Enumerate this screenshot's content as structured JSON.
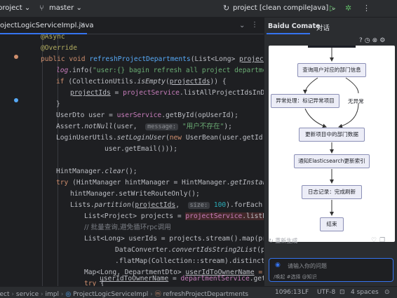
{
  "titlebar": {
    "project": "project",
    "branch": "master",
    "run_config": "project [clean compileJava]"
  },
  "editor": {
    "tab_label": "ojectLogicServiceImpl.java",
    "code": {
      "l0": "@Async",
      "l1": "@Override",
      "l2_a": "public void ",
      "l2_b": "refreshProjectDepartments",
      "l2_c": "(List<Long> ",
      "l2_d": "projectIds",
      "l2_e": ",",
      "l3_a": "log",
      "l3_b": ".info(",
      "l3_c": "\"user:{} bagin refresh all project departments\"",
      "l4_a": "if ",
      "l4_b": "(CollectionUtils.",
      "l4_c": "isEmpty",
      "l4_d": "(",
      "l4_e": "projectIds",
      "l4_f": ")) {",
      "l5_a": "projectIds",
      "l5_b": " = ",
      "l5_c": "projectService",
      "l5_d": ".listAllProjectIdsInDb(",
      "l6": "}",
      "l7_a": "UserDto user = ",
      "l7_b": "userService",
      "l7_c": ".getById(opUserId);",
      "l8_a": "Assert.",
      "l8_b": "notNull",
      "l8_c": "(user,  ",
      "l8_d": "message:",
      "l8_e": " \"用户不存在\"",
      "l8_f": ");",
      "l9_a": "LoginUserUtils.",
      "l9_b": "setLoginUser",
      "l9_c": "(",
      "l9_d": "new ",
      "l9_e": "UserBean(user.getId(), u",
      "l10": "user.getEmail()));",
      "l11_a": "HintManager.",
      "l11_b": "clear",
      "l11_c": "();",
      "l12_a": "try ",
      "l12_b": "(HintManager hintManager = HintManager.",
      "l12_c": "getInstance",
      "l12_d": "()",
      "l13": "hintManager.setWriteRouteOnly();",
      "l14_a": "Lists.",
      "l14_b": "partition",
      "l14_c": "(",
      "l14_d": "projectIds",
      "l14_e": ",  ",
      "l14_f": "size:",
      "l14_g": " 100",
      "l14_h": ").forEach(ids ->",
      "l15_a": "List<Project> projects = ",
      "l15_b": "projectService",
      "l15_c": ".listProj",
      "l16": "// 批量查询,避免循环rpc调用",
      "l17_a": "List<Long> userIds = projects.stream().map(proje",
      "l18_a": "DataConverter.",
      "l18_b": "convertIdsString2List",
      "l18_c": "(proj",
      "l19_a": ".flatMap(Collection::stream).distinct()",
      "l20_a": "Map<Long, DepartmentDto> ",
      "l20_b": "userIdToOwnerName",
      "l20_c": " = new",
      "l21_a": "try ",
      "l21_b": "{",
      "l22_a": "userIdToOwnerName",
      "l22_b": " = ",
      "l22_c": "departmentService",
      "l22_d": ".getOwn"
    }
  },
  "panel": {
    "title": "Baidu Comate",
    "tab": "对话",
    "flowchart": {
      "node1": "查询用户对应的部门信息",
      "node2": "异常处理：标记异常项目",
      "label_no_exception": "无异常",
      "node3": "更新项目中的部门数据",
      "node4": "通知Elasticsearch更新索引",
      "node5": "日志记录：完成刷新",
      "node6": "结束"
    },
    "regenerate": "重新生成",
    "input_placeholder": "请输入你的问题",
    "input_hint": "/唤起  #选择  @知识"
  },
  "statusbar": {
    "breadcrumb": [
      "ject",
      "service",
      "impl",
      "ProjectLogicServiceImpl",
      "refreshProjectDepartments"
    ],
    "position": "1096:13",
    "line_sep": "LF",
    "encoding": "UTF-8",
    "indent": "4 spaces"
  },
  "colors": {
    "accent": "#3574f0",
    "keyword": "#cf8e6d",
    "method": "#56a8f5",
    "field": "#c77dbb",
    "string": "#6aab73",
    "run_green": "#5fb865"
  }
}
